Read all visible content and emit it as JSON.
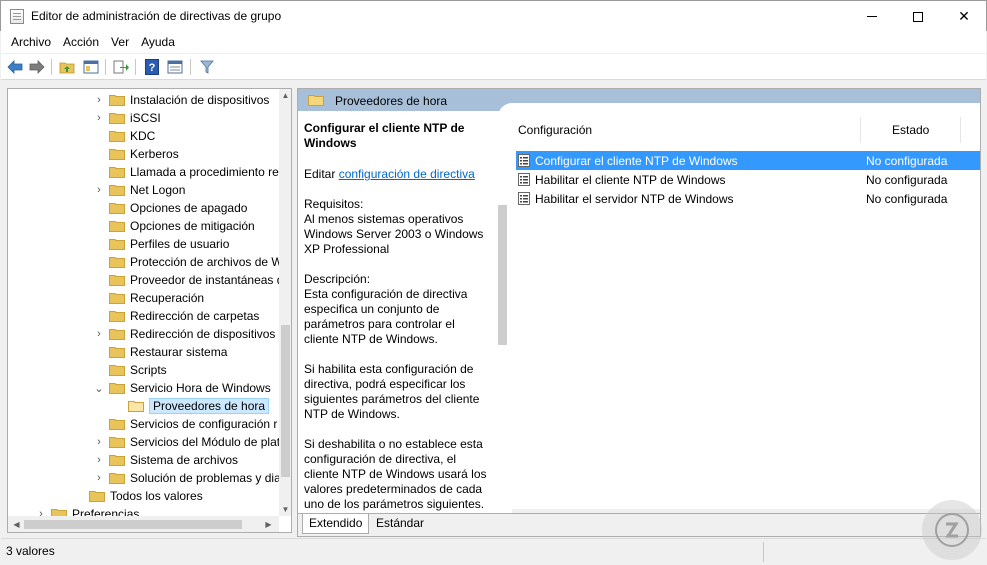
{
  "window": {
    "title": "Editor de administración de directivas de grupo",
    "minimize_glyph": "—",
    "close_glyph": "✕"
  },
  "menu": [
    "Archivo",
    "Acción",
    "Ver",
    "Ayuda"
  ],
  "toolbar": {
    "icons": [
      "back-arrow-icon",
      "forward-arrow-icon",
      "folder-up-icon",
      "show-hide-tree-icon",
      "export-list-icon",
      "help-icon",
      "properties-view-icon",
      "filter-icon"
    ]
  },
  "tree": {
    "items": [
      {
        "label": "Instalación de dispositivos",
        "expander": "›"
      },
      {
        "label": "iSCSI",
        "expander": "›"
      },
      {
        "label": "KDC",
        "expander": ""
      },
      {
        "label": "Kerberos",
        "expander": ""
      },
      {
        "label": "Llamada a procedimiento re",
        "expander": ""
      },
      {
        "label": "Net Logon",
        "expander": "›"
      },
      {
        "label": "Opciones de apagado",
        "expander": ""
      },
      {
        "label": "Opciones de mitigación",
        "expander": ""
      },
      {
        "label": "Perfiles de usuario",
        "expander": ""
      },
      {
        "label": "Protección de archivos de W",
        "expander": ""
      },
      {
        "label": "Proveedor de instantáneas d",
        "expander": ""
      },
      {
        "label": "Recuperación",
        "expander": ""
      },
      {
        "label": "Redirección de carpetas",
        "expander": ""
      },
      {
        "label": "Redirección de dispositivos",
        "expander": "›"
      },
      {
        "label": "Restaurar sistema",
        "expander": ""
      },
      {
        "label": "Scripts",
        "expander": ""
      },
      {
        "label": "Servicio Hora de Windows",
        "expander": "⌄"
      },
      {
        "label": "Proveedores de hora",
        "expander": "",
        "selected": true
      },
      {
        "label": "Servicios de configuración r",
        "expander": ""
      },
      {
        "label": "Servicios del Módulo de plat",
        "expander": "›"
      },
      {
        "label": "Sistema de archivos",
        "expander": "›"
      },
      {
        "label": "Solución de problemas y dia",
        "expander": "›"
      },
      {
        "label": "Todos los valores",
        "expander": ""
      },
      {
        "label": "Preferencias",
        "expander": "›"
      }
    ]
  },
  "right": {
    "header": "Proveedores de hora",
    "description": {
      "title": "Configurar el cliente NTP de Windows",
      "edit_prefix": "Editar",
      "edit_link": "configuración de directiva",
      "requirements": "Requisitos:\nAl menos sistemas operativos Windows Server 2003 o Windows XP Professional",
      "description": "Descripción:\nEsta configuración de directiva especifica un conjunto de parámetros para controlar el cliente NTP de Windows.",
      "p_enable": "Si habilita esta configuración de directiva, podrá especificar los siguientes parámetros del cliente NTP de Windows.",
      "p_disable": "Si deshabilita o no establece esta configuración de directiva, el cliente NTP de Windows usará los valores predeterminados de cada uno de los parámetros siguientes."
    },
    "list": {
      "col_setting": "Configuración",
      "col_state": "Estado",
      "rows": [
        {
          "name": "Configurar el cliente NTP de Windows",
          "state": "No configurada",
          "selected": true
        },
        {
          "name": "Habilitar el cliente NTP de Windows",
          "state": "No configurada"
        },
        {
          "name": "Habilitar el servidor NTP de Windows",
          "state": "No configurada"
        }
      ]
    },
    "tabs": [
      "Extendido",
      "Estándar"
    ]
  },
  "status": {
    "text": "3 valores"
  },
  "colors": {
    "selection": "#3399ff",
    "header_band": "#a8bfd9",
    "link": "#0066cc",
    "folder": "#e8c45a"
  }
}
